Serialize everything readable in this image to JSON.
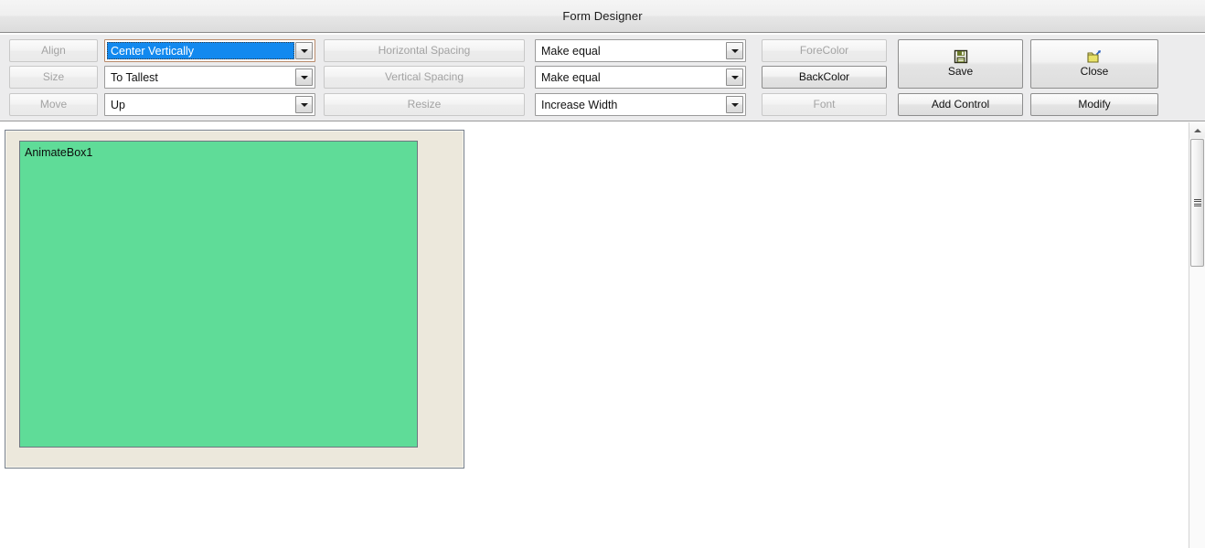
{
  "window": {
    "title": "Form Designer"
  },
  "toolbar": {
    "action_buttons": [
      {
        "name": "align-button",
        "label": "Align",
        "enabled": false
      },
      {
        "name": "size-button",
        "label": "Size",
        "enabled": false
      },
      {
        "name": "move-button",
        "label": "Move",
        "enabled": false
      }
    ],
    "action_combos": [
      {
        "name": "align-mode-combo",
        "value": "Center Vertically",
        "focused": true
      },
      {
        "name": "size-mode-combo",
        "value": "To Tallest",
        "focused": false
      },
      {
        "name": "move-mode-combo",
        "value": "Up",
        "focused": false
      }
    ],
    "spacing_buttons": [
      {
        "name": "horizontal-spacing-button",
        "label": "Horizontal Spacing",
        "enabled": false
      },
      {
        "name": "vertical-spacing-button",
        "label": "Vertical Spacing",
        "enabled": false
      },
      {
        "name": "resize-button",
        "label": "Resize",
        "enabled": false
      }
    ],
    "spacing_combos": [
      {
        "name": "horizontal-spacing-combo",
        "value": "Make equal"
      },
      {
        "name": "vertical-spacing-combo",
        "value": "Make equal"
      },
      {
        "name": "resize-combo",
        "value": "Increase Width"
      }
    ],
    "style_buttons": [
      {
        "name": "forecolor-button",
        "label": "ForeColor",
        "enabled": false
      },
      {
        "name": "backcolor-button",
        "label": "BackColor",
        "enabled": true
      },
      {
        "name": "font-button",
        "label": "Font",
        "enabled": false
      }
    ],
    "command_buttons": {
      "save": {
        "label": "Save",
        "icon": "floppy-disk-icon"
      },
      "close": {
        "label": "Close",
        "icon": "export-box-icon"
      },
      "add_control": {
        "label": "Add Control"
      },
      "modify": {
        "label": "Modify"
      }
    }
  },
  "designer": {
    "form_panel_name": "form-design-surface",
    "controls": [
      {
        "name": "animate-box-control",
        "label": "AnimateBox1",
        "backcolor": "#5fdc98"
      }
    ]
  },
  "colors": {
    "selection_blue": "#1289ef",
    "control_green": "#5fdc98",
    "form_beige": "#ece8dc",
    "toolbar_gray": "#ececed"
  }
}
